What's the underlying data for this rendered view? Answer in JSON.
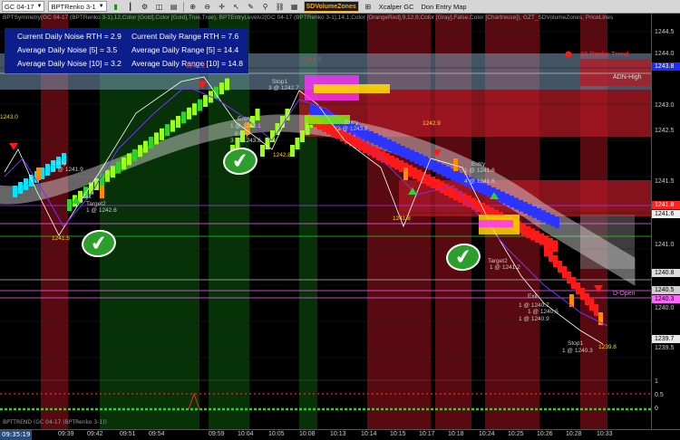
{
  "toolbar": {
    "instrument": "GC 04-17",
    "bar_type": "BPTRenko 3-1",
    "sdvolume": "SDVolumeZones",
    "xcalper": "Xcalper GC",
    "entry_map": "Don Entry Map"
  },
  "legend": {
    "line1": "BPTSymmetry(GC 04-17 (BPTRenko 3-1),12,Color [Gold],Color [Gold],True,True), BPTEntryLevelv2(GC 04-17 (BPTRenko 3-1),14,1,Color [OrangeRed],9,12,9,Color [Gray],False,Color [Chartreuse]), GZT_SDVolumeZones, PriceLines",
    "line2": "BPTTREND (GC 04-17 (BPTRenko 3-1))"
  },
  "stats": {
    "rth_noise": "Current Daily Noise RTH = 2.9",
    "rth_range": "Current Daily Range RTH = 7.6",
    "avg_noise5": "Average Daily Noise [5] = 3.5",
    "avg_range5": "Average Daily Range [5] = 14.4",
    "avg_noise10": "Average Daily Noise [10] = 3.2",
    "avg_range10": "Average Daily Range [10] = 14.8"
  },
  "trend_label": "10 Renko Trend",
  "adn_high": "ADN-High",
  "d_open": "D-Open",
  "price_axis": [
    "1244.5",
    "1244.0",
    "1243.5",
    "1243.0",
    "1242.5",
    "1242.0",
    "1241.5",
    "1241.0",
    "1240.5",
    "1240.0",
    "1239.5"
  ],
  "price_tags": {
    "t1": "1243.8",
    "t2": "1241.8",
    "t3": "1241.6",
    "t4": "1240.8",
    "t5": "1240.5",
    "t6": "1240.3",
    "t7": "1239.7"
  },
  "sub_axis": {
    "a": "1",
    "b": "0.5",
    "c": "0"
  },
  "time_axis": [
    "09:39",
    "09:42",
    "09:51",
    "09:54",
    "09:59",
    "10:04",
    "10:05",
    "10:08",
    "10:13",
    "10:14",
    "10:15",
    "10:17",
    "10:18",
    "10:24",
    "10:25",
    "10:26",
    "10:28",
    "10:33"
  ],
  "time_tag": "09:35:19",
  "annotations": {
    "p1243_0": "1243.0",
    "p1241_5": "1241.5",
    "entry1": "Entry",
    "entry1b": "1 @ 1241.9",
    "exit1": "Exit",
    "target1": "Target2",
    "target1b": "1 @ 1242.6",
    "p1244_2": "1244.2",
    "entry2": "Entry",
    "entry2b": "1 @ 1243.1",
    "entry2c": "Entry",
    "entry2d": "3 @ 1243.8",
    "p1242_8": "1242.8",
    "stop1": "Stop1",
    "stop1b": "3 @ 1242.7",
    "p1243_9": "1243.9",
    "entry3": "Entry",
    "entry3b": "3 @ 1243.5",
    "p1242_9": "1242.9",
    "p1241_8": "1241.8",
    "entry4": "Entry",
    "entry4b": "1 @ 1241.6",
    "entry4c": "4 @ 1241.6",
    "target2": "Target2",
    "target2b": "1 @ 1241.2",
    "exit2": "Exit",
    "exit2b": "1 @ 1240.7",
    "exit2c": "1 @ 1240.5",
    "exit2d": "1 @ 1240.9",
    "stop2": "Stop1",
    "stop2b": "1 @ 1240.3",
    "p1239_8": "1239.8"
  },
  "colors": {
    "bull_bright": "#9aff1a",
    "bull_green": "#2fd12f",
    "bull_cyan": "#00e5ff",
    "bear_red": "#ff1a1a",
    "bear_blue": "#2b35ff",
    "zone_red": "#a3131d",
    "zone_green": "#0d5a0d",
    "stats_bg": "#0b1e8c"
  }
}
